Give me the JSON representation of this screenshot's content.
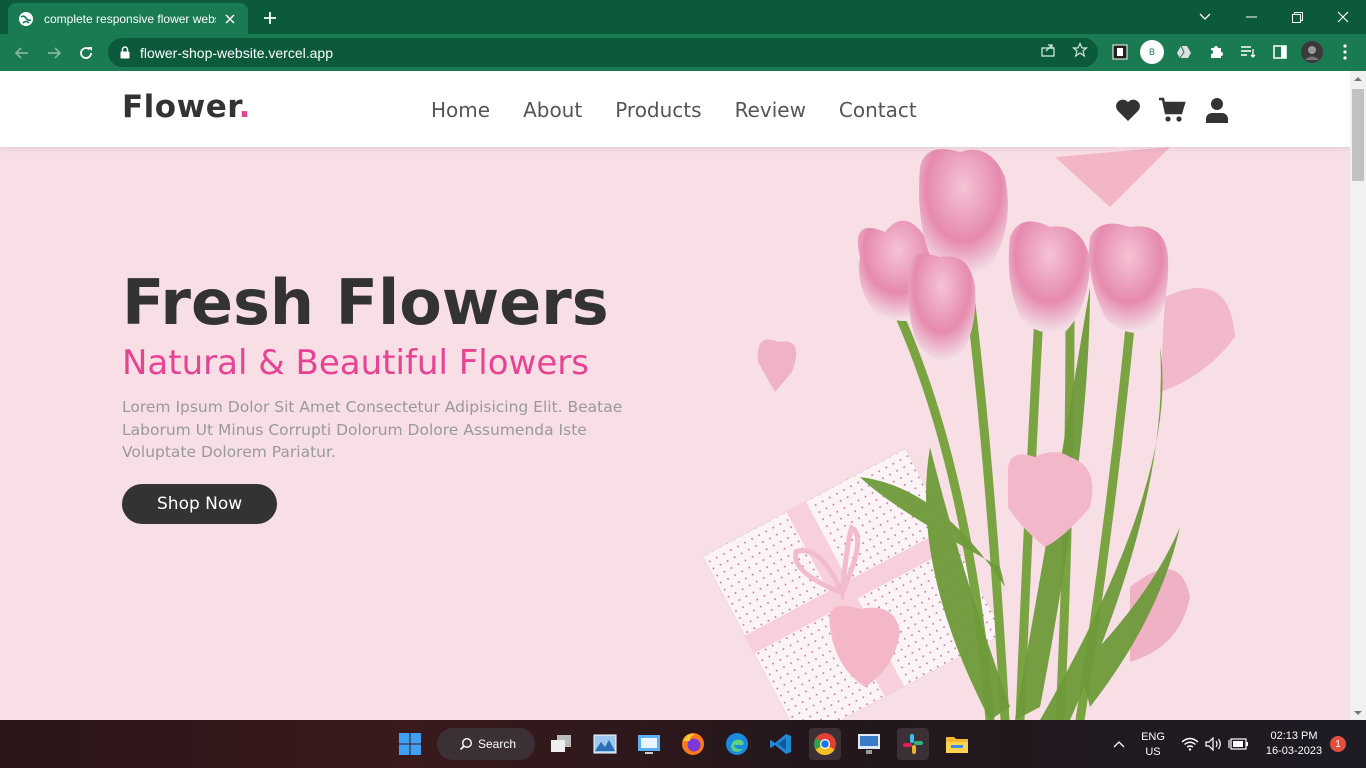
{
  "browser": {
    "tab_title": "complete responsive flower webs",
    "url": "flower-shop-website.vercel.app",
    "profile_initial": "B"
  },
  "site": {
    "logo_text": "Flower",
    "logo_dot": ".",
    "nav": [
      "Home",
      "About",
      "Products",
      "Review",
      "Contact"
    ],
    "hero": {
      "title": "Fresh Flowers",
      "subtitle": "Natural & Beautiful Flowers",
      "description": "Lorem Ipsum Dolor Sit Amet Consectetur Adipisicing Elit. Beatae Laborum Ut Minus Corrupti Dolorum Dolore Assumenda Iste Voluptate Dolorem Pariatur.",
      "button": "Shop Now"
    },
    "colors": {
      "accent": "#e84393",
      "dark": "#333333",
      "hero_bg": "#f8dfe6"
    }
  },
  "taskbar": {
    "search_label": "Search",
    "lang": "ENG",
    "region": "US",
    "time": "02:13 PM",
    "date": "16-03-2023",
    "notifications": "1"
  }
}
